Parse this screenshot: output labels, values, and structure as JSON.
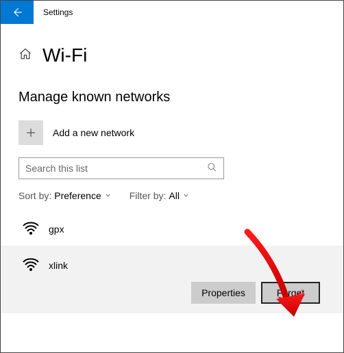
{
  "title": "Settings",
  "page_title": "Wi-Fi",
  "section_title": "Manage known networks",
  "add_label": "Add a new network",
  "search": {
    "placeholder": "Search this list"
  },
  "filters": {
    "sort": {
      "label": "Sort by:",
      "value": "Preference"
    },
    "filter": {
      "label": "Filter by:",
      "value": "All"
    }
  },
  "networks": [
    {
      "name": "gpx"
    },
    {
      "name": "xlink"
    }
  ],
  "buttons": {
    "properties": "Properties",
    "forget": "Forget"
  }
}
